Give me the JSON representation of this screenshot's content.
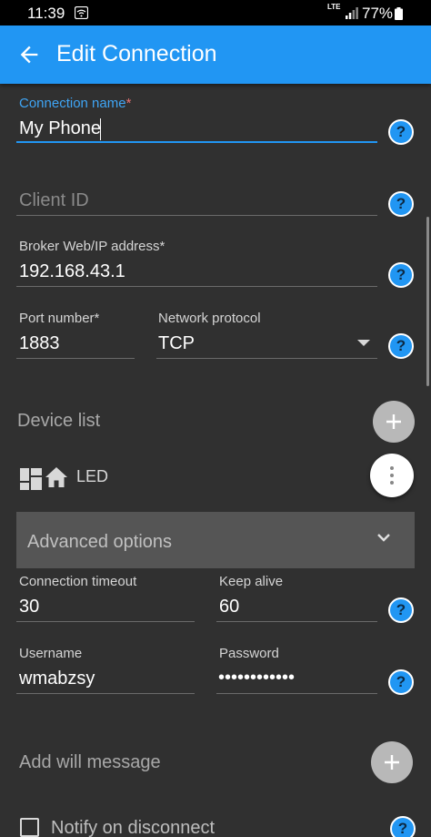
{
  "status_bar": {
    "time": "11:39",
    "network": "LTE",
    "battery_percent": "77%",
    "battery_level": 0.77
  },
  "app_bar": {
    "title": "Edit Connection",
    "back_icon": "arrow-left-icon",
    "color": "#2196f3"
  },
  "connection_name": {
    "label": "Connection name",
    "required": "*",
    "value": "My Phone"
  },
  "client_id": {
    "placeholder": "Client ID"
  },
  "broker": {
    "label": "Broker Web/IP address",
    "required": "*",
    "value": "192.168.43.1"
  },
  "port": {
    "label": "Port number",
    "required": "*",
    "value": "1883"
  },
  "protocol": {
    "label": "Network protocol",
    "value": "TCP"
  },
  "device_list": {
    "label": "Device list",
    "items": [
      {
        "name": "LED",
        "icons": [
          "dashboard-icon",
          "home-icon"
        ]
      }
    ]
  },
  "advanced_options": {
    "label": "Advanced options"
  },
  "connection_timeout": {
    "label": "Connection timeout",
    "value": "30"
  },
  "keep_alive": {
    "label": "Keep alive",
    "value": "60"
  },
  "username": {
    "label": "Username",
    "value": "wmabzsy"
  },
  "password": {
    "label": "Password",
    "value": "••••••••••••"
  },
  "will_message": {
    "label": "Add will message"
  },
  "notify_on_disconnect": {
    "label": "Notify on disconnect",
    "checked": false
  },
  "help_icon_text": "?",
  "colors": {
    "accent": "#2196f3",
    "background": "#303030",
    "field_focus_label": "#3fa5f5"
  }
}
